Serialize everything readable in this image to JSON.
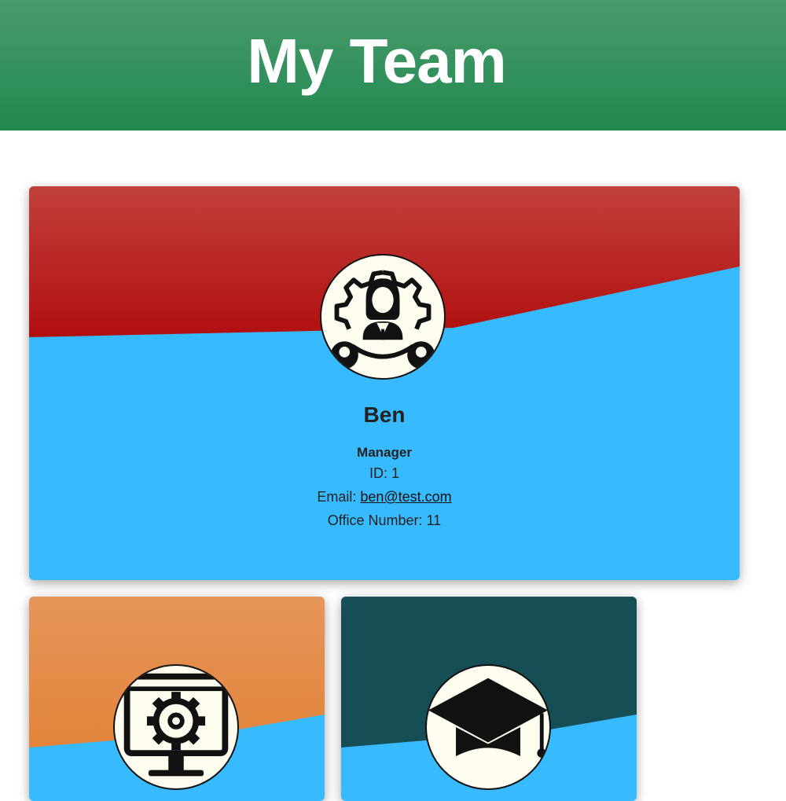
{
  "header": {
    "title": "My Team",
    "color": "#21894f"
  },
  "cards": [
    {
      "name": "Ben",
      "role": "Manager",
      "id_label": "ID: 1",
      "email_label": "Email: ",
      "email": "ben@test.com",
      "extra_label": "Office Number: 11",
      "icon": "manager-icon",
      "top_color": "#b31515",
      "bottom_color": "#38bbfe"
    },
    {
      "icon": "engineer-icon",
      "top_color": "#e08a3e",
      "bottom_color": "#38bbfe"
    },
    {
      "icon": "intern-icon",
      "top_color": "#154f55",
      "bottom_color": "#38bbfe"
    }
  ]
}
